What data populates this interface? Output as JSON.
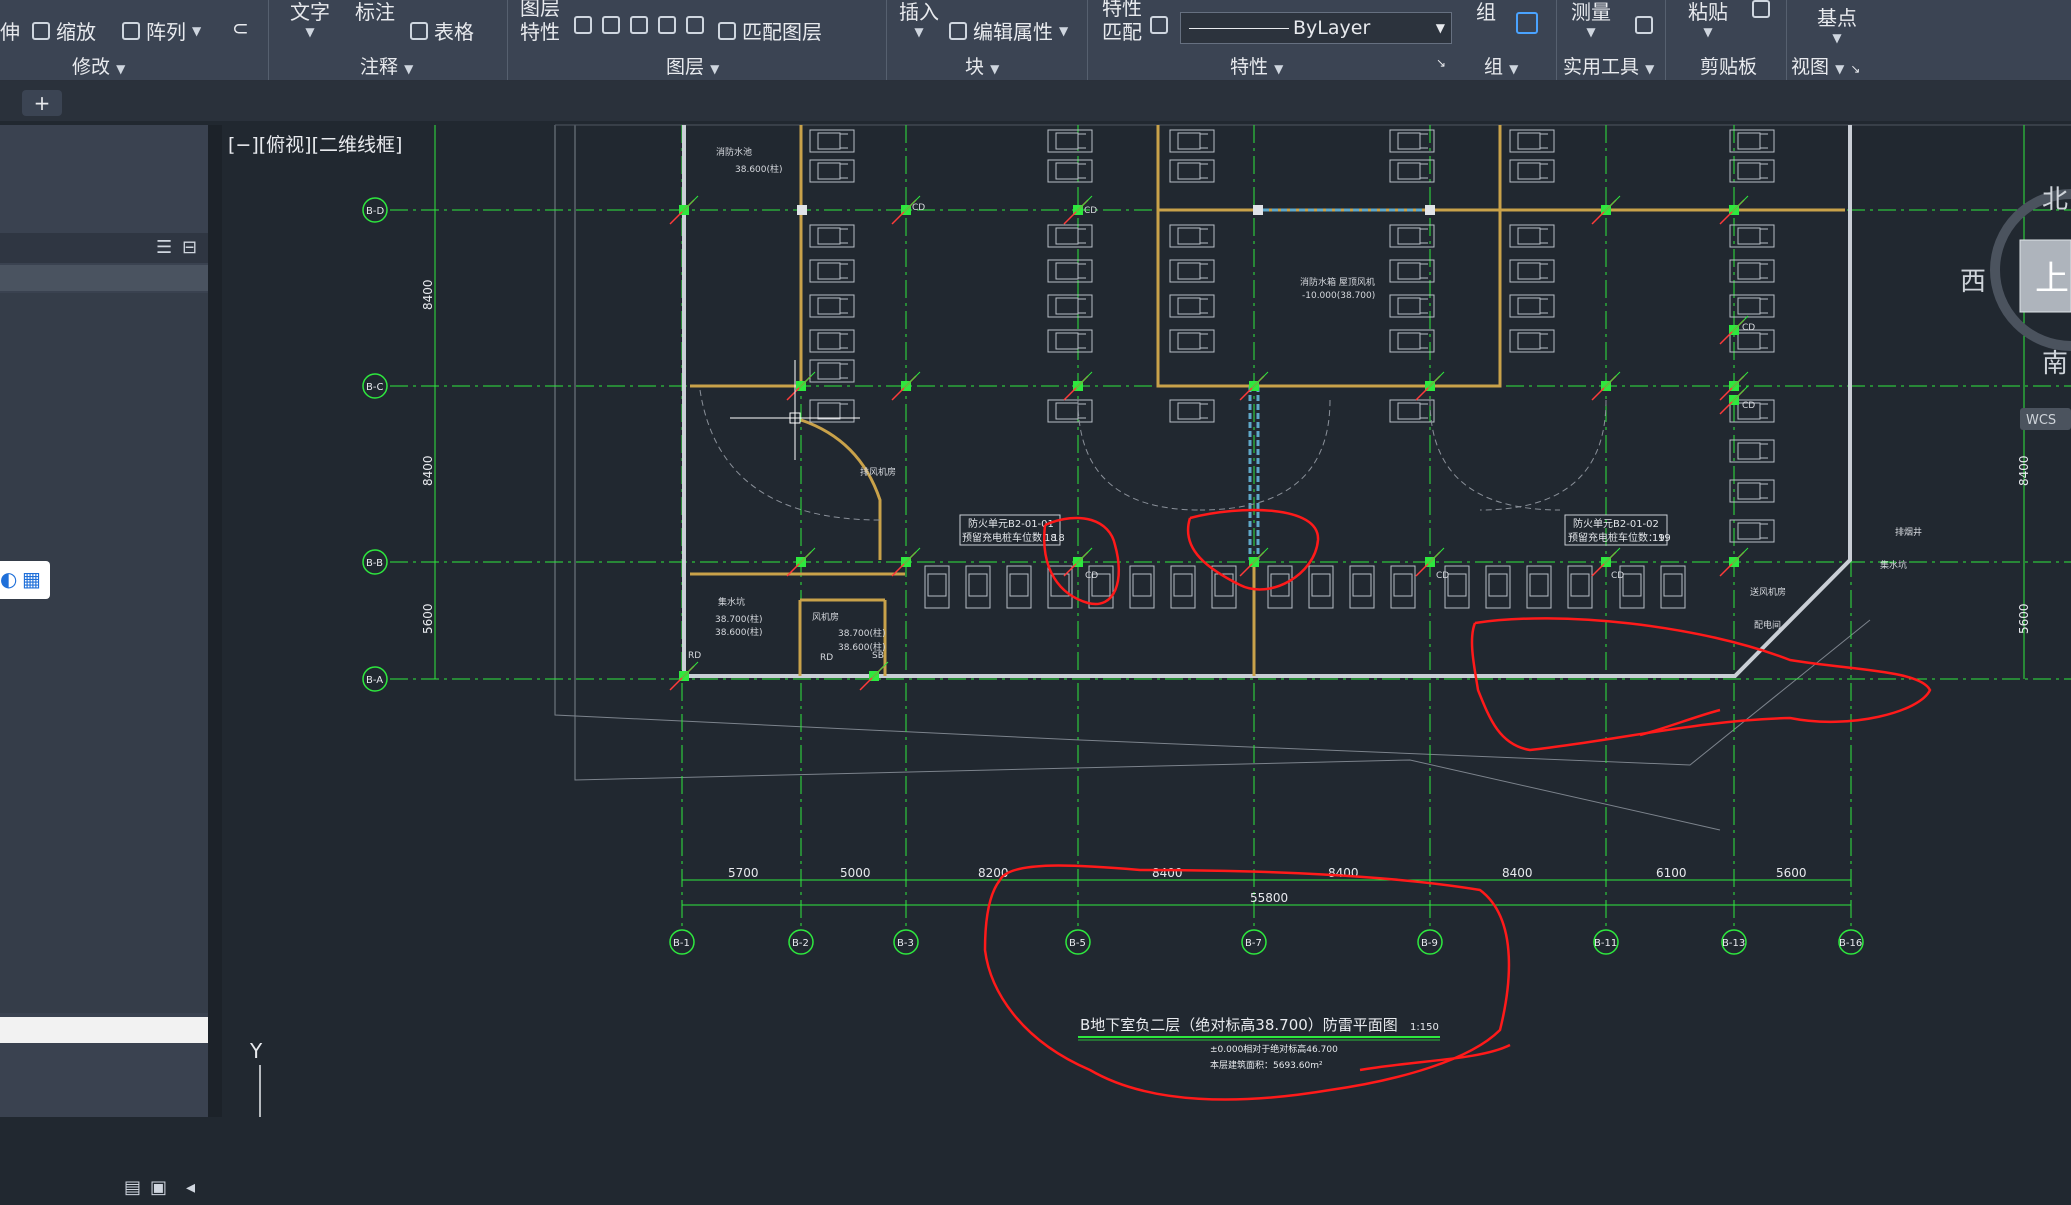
{
  "ribbon": {
    "row1": {
      "text_tool": "文字",
      "dim_tool": "标注",
      "layer_props": [
        "图层",
        "特性"
      ],
      "insert": "插入",
      "match_props": [
        "特性",
        "匹配"
      ],
      "group": "组",
      "measure": "测量",
      "paste": "粘贴",
      "base_point": "基点"
    },
    "row2": {
      "stretch": "伸",
      "scale": "缩放",
      "array": "阵列",
      "table": "表格",
      "match_layer": "匹配图层",
      "edit_attr": "编辑属性",
      "bylayer": "ByLayer"
    },
    "groups": {
      "modify": "修改",
      "annotation": "注释",
      "layers": "图层",
      "block": "块",
      "properties": "特性",
      "groups": "组",
      "utilities": "实用工具",
      "clipboard": "剪贴板",
      "view": "视图"
    }
  },
  "tabs": {
    "add_tab": "+"
  },
  "viewport": {
    "label": "[−][俯视][二维线框]"
  },
  "viewcube": {
    "north": "北",
    "west": "西",
    "south": "南",
    "top_face": "上",
    "wcs": "WCS"
  },
  "ucs": {
    "y_label": "Y"
  },
  "drawing": {
    "row_axes": [
      "B-D",
      "B-C",
      "B-B",
      "B-A"
    ],
    "col_axes": [
      "B-1",
      "B-2",
      "B-3",
      "B-5",
      "B-7",
      "B-9",
      "B-11",
      "B-13",
      "B-16"
    ],
    "row_dims": [
      "8400",
      "8400",
      "5600"
    ],
    "col_dims": [
      "5700",
      "5000",
      "8200",
      "8400",
      "8400",
      "8400",
      "6100",
      "5600"
    ],
    "total_dim": "55800",
    "title": "B地下室负二层（绝对标高38.700）防雷平面图",
    "scale": "1:150",
    "note1": "±0.000相对于绝对标高46.700",
    "note2": "本层建筑面积：5693.60m²",
    "fire_zone_1": [
      "防火单元B2-01-01",
      "预留充电桩车位数：18"
    ],
    "fire_zone_2": [
      "防火单元B2-01-02",
      "预留充电桩车位数：19"
    ],
    "room_labels": [
      "消防水池",
      "排风机房",
      "风机房",
      "送风机房",
      "集水坑"
    ],
    "cd_label": "CD",
    "rd_label": "RD",
    "sb_label": "SB"
  }
}
